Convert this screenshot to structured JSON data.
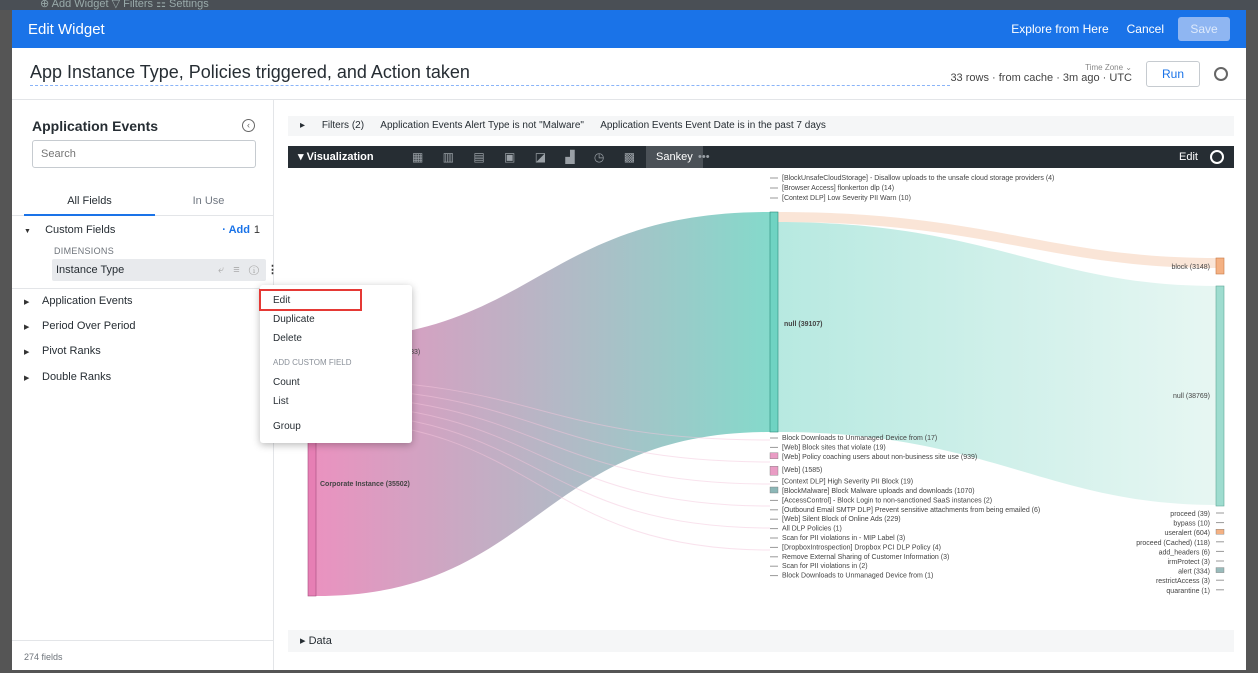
{
  "background": {
    "text": "⊕  Add Widget   ▽  Filters   ☷  Settings"
  },
  "header": {
    "title": "Edit Widget",
    "explore_label": "Explore from Here",
    "cancel_label": "Cancel",
    "save_label": "Save",
    "accent": "#1a73e8"
  },
  "widget": {
    "title": "App Instance Type, Policies triggered, and Action taken",
    "meta": "33 rows · from cache · 3m ago · UTC",
    "timezone_label": "Time Zone ⌄",
    "run_label": "Run"
  },
  "sidebar": {
    "heading": "Application Events",
    "search_placeholder": "Search",
    "tabs": [
      "All Fields",
      "In Use"
    ],
    "custom_fields": {
      "label": "Custom Fields",
      "add": "· Add",
      "count": "1"
    },
    "dimensions_label": "DIMENSIONS",
    "field": {
      "label": "Instance Type",
      "icons": "⤶ ≡ ⓘ"
    },
    "groups": [
      "Application Events",
      "Period Over Period",
      "Pivot Ranks",
      "Double Ranks"
    ],
    "field_count": "274 fields"
  },
  "context_menu": {
    "items": [
      "Edit",
      "Duplicate",
      "Delete"
    ],
    "section_header": "ADD CUSTOM FIELD",
    "custom_items": [
      "Count",
      "List"
    ],
    "group_item": "Group"
  },
  "filters": {
    "label": "Filters (2)",
    "conditions": [
      "Application Events Alert Type is not \"Malware\"",
      "Application Events Event Date is in the past 7 days"
    ]
  },
  "visualization": {
    "label": "Visualization",
    "type_icons": "▦ ▥ ▤ ▣ ◪ ▟ ◷ ▩ ⑥",
    "active_type": "Sankey",
    "more": "•••",
    "edit_label": "Edit"
  },
  "data_section": {
    "label": "Data"
  },
  "chart_data": {
    "type": "sankey",
    "columns": [
      {
        "nodes": [
          {
            "label": "(3633)",
            "value": 3633
          },
          {
            "label": "Corporate Instance (35502)",
            "value": 35502
          }
        ]
      },
      {
        "nodes": [
          {
            "label": "[BlockUnsafeCloudStorage] - Disallow uploads to the unsafe cloud storage providers (4)",
            "value": 4
          },
          {
            "label": "[Browser Access] flonkerton dlp (14)",
            "value": 14
          },
          {
            "label": "[Context DLP] Low Severity PII Warn (10)",
            "value": 10
          },
          {
            "label": "null (39107)",
            "value": 39107
          },
          {
            "label": "Block Downloads to Unmanaged Device from (17)",
            "value": 17
          },
          {
            "label": "[Web] Block sites that violate (19)",
            "value": 19
          },
          {
            "label": "[Web] Policy coaching users about non-business site use (939)",
            "value": 939
          },
          {
            "label": "[Web] (1585)",
            "value": 1585
          },
          {
            "label": "[Context DLP] High Severity PII Block (19)",
            "value": 19
          },
          {
            "label": "[BlockMalware] Block Malware uploads and downloads (1070)",
            "value": 1070
          },
          {
            "label": "[AccessControl] - Block Login to non-sanctioned SaaS instances (2)",
            "value": 2
          },
          {
            "label": "[Outbound Email SMTP DLP] Prevent sensitive attachments from being emailed (6)",
            "value": 6
          },
          {
            "label": "[Web] Silent Block of Online Ads (229)",
            "value": 229
          },
          {
            "label": "All DLP Policies (1)",
            "value": 1
          },
          {
            "label": "Scan for PII violations in - MIP Label (3)",
            "value": 3
          },
          {
            "label": "[DropboxIntrospection] Dropbox PCI DLP Policy (4)",
            "value": 4
          },
          {
            "label": "Remove External Sharing of Customer Information (3)",
            "value": 3
          },
          {
            "label": "Scan for PII violations in (2)",
            "value": 2
          },
          {
            "label": "Block Downloads to Unmanaged Device from (1)",
            "value": 1
          }
        ]
      },
      {
        "nodes": [
          {
            "label": "block (3148)",
            "value": 3148
          },
          {
            "label": "null (38769)",
            "value": 38769
          },
          {
            "label": "proceed (39)",
            "value": 39
          },
          {
            "label": "bypass (10)",
            "value": 10
          },
          {
            "label": "useralert (604)",
            "value": 604
          },
          {
            "label": "proceed (Cached) (118)",
            "value": 118
          },
          {
            "label": "add_headers (6)",
            "value": 6
          },
          {
            "label": "irmProtect (3)",
            "value": 3
          },
          {
            "label": "alert (334)",
            "value": 334
          },
          {
            "label": "restrictAccess (3)",
            "value": 3
          },
          {
            "label": "quarantine (1)",
            "value": 1
          }
        ]
      }
    ],
    "colors": {
      "source": "#e67fb4",
      "mid": "#6fd3c2",
      "block": "#f4b183",
      "null_out": "#9edccf",
      "malware": "#8cb7b7"
    }
  }
}
